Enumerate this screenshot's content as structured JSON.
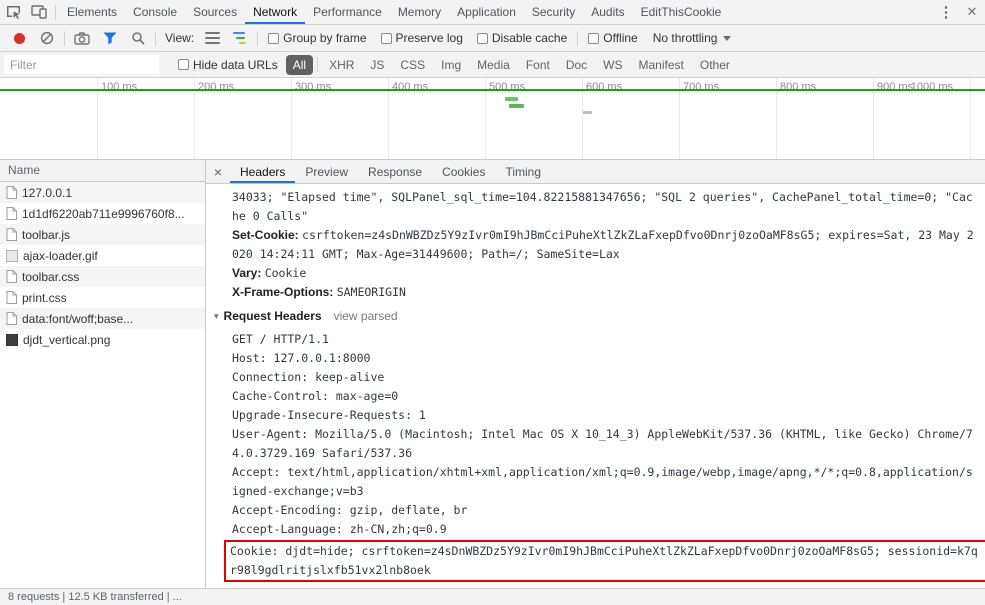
{
  "icons": {
    "more_tools": "⋮",
    "close": "✕",
    "detail_close": "×",
    "disclosure": "▾"
  },
  "colors": {
    "accent_blue": "#1a73e8",
    "record_red": "#d93025",
    "highlight_red": "#e60000",
    "timeline_green": "#12a812",
    "filter_active_bg": "#616161"
  },
  "main_tabs": {
    "items": [
      "Elements",
      "Console",
      "Sources",
      "Network",
      "Performance",
      "Memory",
      "Application",
      "Security",
      "Audits",
      "EditThisCookie"
    ],
    "active": "Network"
  },
  "network_toolbar": {
    "view_label": "View:",
    "group_by_frame": "Group by frame",
    "preserve_log": "Preserve log",
    "disable_cache": "Disable cache",
    "offline": "Offline",
    "throttling": "No throttling"
  },
  "filter_bar": {
    "filter_placeholder": "Filter",
    "hide_data_urls": "Hide data URLs",
    "type_filters": [
      "All",
      "XHR",
      "JS",
      "CSS",
      "Img",
      "Media",
      "Font",
      "Doc",
      "WS",
      "Manifest",
      "Other"
    ],
    "active_filter": "All"
  },
  "timeline": {
    "ticks": [
      "100 ms",
      "200 ms",
      "300 ms",
      "400 ms",
      "500 ms",
      "600 ms",
      "700 ms",
      "800 ms",
      "900 ms",
      "1000 ms"
    ]
  },
  "request_list": {
    "column_header": "Name",
    "rows": [
      {
        "label": "127.0.0.1"
      },
      {
        "label": "1d1df6220ab711e9996760f8..."
      },
      {
        "label": "toolbar.js"
      },
      {
        "label": "ajax-loader.gif"
      },
      {
        "label": "toolbar.css"
      },
      {
        "label": "print.css"
      },
      {
        "label": "data:font/woff;base..."
      },
      {
        "label": "djdt_vertical.png"
      }
    ]
  },
  "details": {
    "tabs": [
      "Headers",
      "Preview",
      "Response",
      "Cookies",
      "Timing"
    ],
    "active_tab": "Headers",
    "wrapped_value_line": "34033; \"Elapsed time\", SQLPanel_sql_time=104.82215881347656; \"SQL 2 queries\", CachePanel_total_time=0; \"Cache 0 Calls\"",
    "response_headers": [
      {
        "name": "Set-Cookie:",
        "value": "csrftoken=z4sDnWBZDz5Y9zIvr0mI9hJBmCciPuheXtlZkZLaFxepDfvo0Dnrj0zoOaMF8sG5; expires=Sat, 23 May 2020 14:24:11 GMT; Max-Age=31449600; Path=/; SameSite=Lax"
      },
      {
        "name": "Vary:",
        "value": "Cookie"
      },
      {
        "name": "X-Frame-Options:",
        "value": "SAMEORIGIN"
      }
    ],
    "request_headers_title": "Request Headers",
    "view_parsed_link": "view parsed",
    "raw_request_lines": [
      "GET / HTTP/1.1",
      "Host: 127.0.0.1:8000",
      "Connection: keep-alive",
      "Cache-Control: max-age=0",
      "Upgrade-Insecure-Requests: 1",
      "User-Agent: Mozilla/5.0 (Macintosh; Intel Mac OS X 10_14_3) AppleWebKit/537.36 (KHTML, like Gecko) Chrome/74.0.3729.169 Safari/537.36",
      "Accept: text/html,application/xhtml+xml,application/xml;q=0.9,image/webp,image/apng,*/*;q=0.8,application/signed-exchange;v=b3",
      "Accept-Encoding: gzip, deflate, br",
      "Accept-Language: zh-CN,zh;q=0.9"
    ],
    "highlighted_cookie_line": "Cookie: djdt=hide; csrftoken=z4sDnWBZDz5Y9zIvr0mI9hJBmCciPuheXtlZkZLaFxepDfvo0Dnrj0zoOaMF8sG5; sessionid=k7qr98l9gdlritjslxfb51vx2lnb8oek"
  },
  "status_bar": {
    "summary": "8 requests | 12.5 KB transferred | ..."
  }
}
